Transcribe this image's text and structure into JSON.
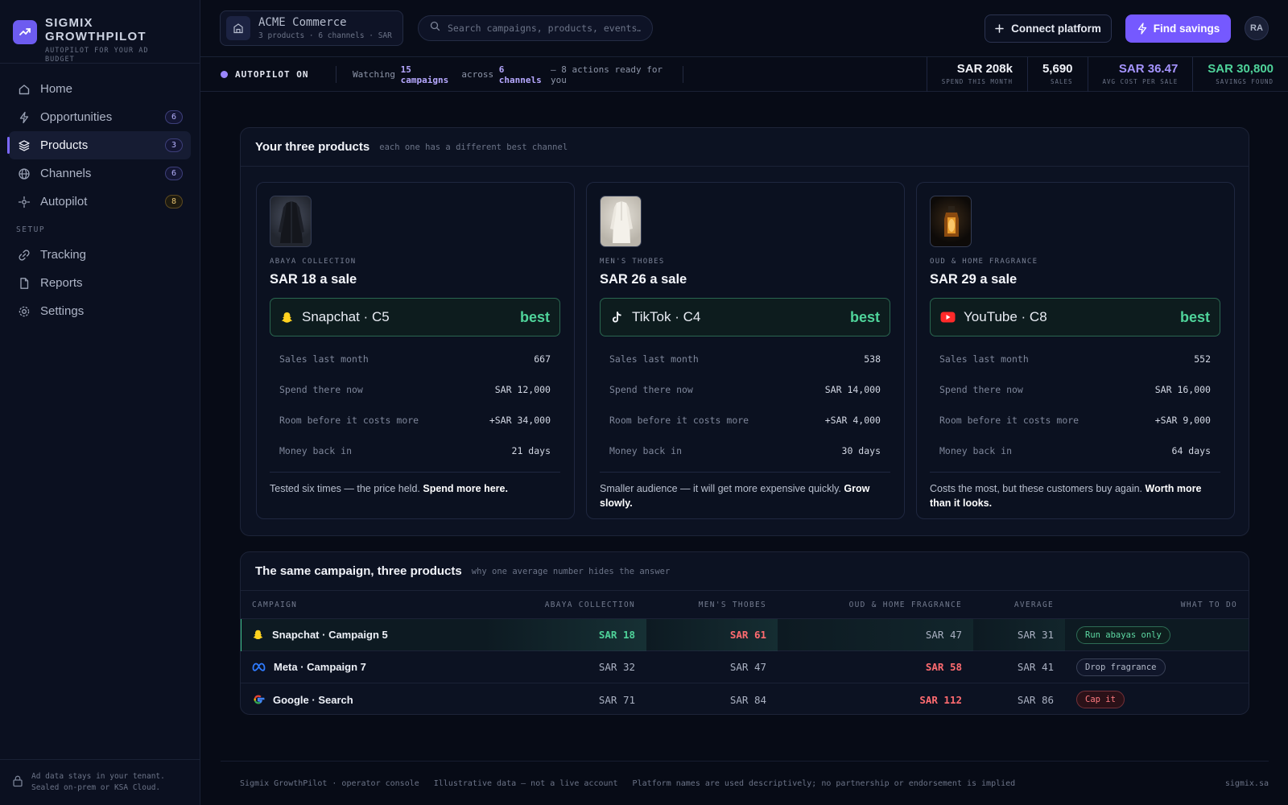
{
  "brand": {
    "name": "SIGMIX GROWTHPILOT",
    "tagline": "AUTOPILOT FOR YOUR AD BUDGET"
  },
  "sidebar": {
    "items": [
      {
        "label": "Home",
        "icon": "home-icon",
        "badge": ""
      },
      {
        "label": "Opportunities",
        "icon": "bolt-icon",
        "badge": "6"
      },
      {
        "label": "Products",
        "icon": "layers-icon",
        "badge": "3",
        "active": true
      },
      {
        "label": "Channels",
        "icon": "globe-icon",
        "badge": "6"
      },
      {
        "label": "Autopilot",
        "icon": "autopilot-icon",
        "badge": "8"
      }
    ],
    "section_label": "SETUP",
    "setup_items": [
      {
        "label": "Tracking",
        "icon": "link-icon"
      },
      {
        "label": "Reports",
        "icon": "file-icon"
      },
      {
        "label": "Settings",
        "icon": "gear-icon"
      }
    ],
    "footer_line1": "Ad data stays in your tenant.",
    "footer_line2": "Sealed on-prem or KSA Cloud."
  },
  "header": {
    "account_name": "ACME Commerce",
    "account_sub": "3 products · 6 channels · SAR",
    "search_placeholder": "Search campaigns, products, events…",
    "connect_label": "Connect platform",
    "savings_label": "Find savings",
    "avatar_initials": "RA"
  },
  "status": {
    "autopilot_label": "AUTOPILOT ON",
    "watching_prefix": "Watching",
    "campaigns": "15 campaigns",
    "across": "across",
    "channels": "6 channels",
    "suffix": "— 8 actions ready for you",
    "kpis": [
      {
        "value": "SAR 208k",
        "label": "SPEND THIS MONTH"
      },
      {
        "value": "5,690",
        "label": "SALES"
      },
      {
        "value": "SAR 36.47",
        "label": "AVG COST PER SALE"
      },
      {
        "value": "SAR 30,800",
        "label": "SAVINGS FOUND"
      }
    ]
  },
  "products_panel": {
    "title": "Your three products",
    "subtitle": "each one has a different best channel",
    "stat_labels": [
      "Sales last month",
      "Spend there now",
      "Room before it costs more",
      "Money back in"
    ],
    "best_label": "best",
    "products": [
      {
        "category": "ABAYA COLLECTION",
        "cost": "SAR 18 a sale",
        "channel": "Snapchat · C5",
        "channel_icon": "snapchat-icon",
        "stats": [
          "667",
          "SAR 12,000",
          "+SAR 34,000",
          "21 days"
        ],
        "note": "Tested six times — the price held.",
        "note_strong": "Spend more here."
      },
      {
        "category": "MEN'S THOBES",
        "cost": "SAR 26 a sale",
        "channel": "TikTok · C4",
        "channel_icon": "tiktok-icon",
        "stats": [
          "538",
          "SAR 14,000",
          "+SAR 4,000",
          "30 days"
        ],
        "note": "Smaller audience — it will get more expensive quickly.",
        "note_strong": "Grow slowly."
      },
      {
        "category": "OUD & HOME FRAGRANCE",
        "cost": "SAR 29 a sale",
        "channel": "YouTube · C8",
        "channel_icon": "youtube-icon",
        "stats": [
          "552",
          "SAR 16,000",
          "+SAR 9,000",
          "64 days"
        ],
        "note": "Costs the most, but these customers buy again.",
        "note_strong": "Worth more than it looks."
      }
    ]
  },
  "table": {
    "title": "The same campaign, three products",
    "subtitle": "why one average number hides the answer",
    "headers": [
      "CAMPAIGN",
      "ABAYA COLLECTION",
      "MEN'S THOBES",
      "OUD & HOME FRAGRANCE",
      "AVERAGE",
      "WHAT TO DO"
    ],
    "rows": [
      {
        "campaign": "Snapchat · Campaign 5",
        "icon": "snapchat-icon",
        "abaya": "SAR 18",
        "thobes": "SAR 61",
        "oud": "SAR 47",
        "avg": "SAR 31",
        "action": "Run abayas only"
      },
      {
        "campaign": "Meta · Campaign 7",
        "icon": "meta-icon",
        "abaya": "SAR 32",
        "thobes": "SAR 47",
        "oud": "SAR 58",
        "avg": "SAR 41",
        "action": "Drop fragrance"
      },
      {
        "campaign": "Google · Search",
        "icon": "google-icon",
        "abaya": "SAR 71",
        "thobes": "SAR 84",
        "oud": "SAR 112",
        "avg": "SAR 86",
        "action": "Cap it"
      }
    ]
  },
  "footer": {
    "left1": "Sigmix GrowthPilot · operator console",
    "left2": "Illustrative data — not a live account",
    "left3": "Platform names are used descriptively; no partnership or endorsement is implied",
    "site": "sigmix.sa"
  },
  "colors": {
    "accent": "#7559ff",
    "good": "#4fd39a",
    "bad": "#ff6b70",
    "background": "#070b16"
  }
}
